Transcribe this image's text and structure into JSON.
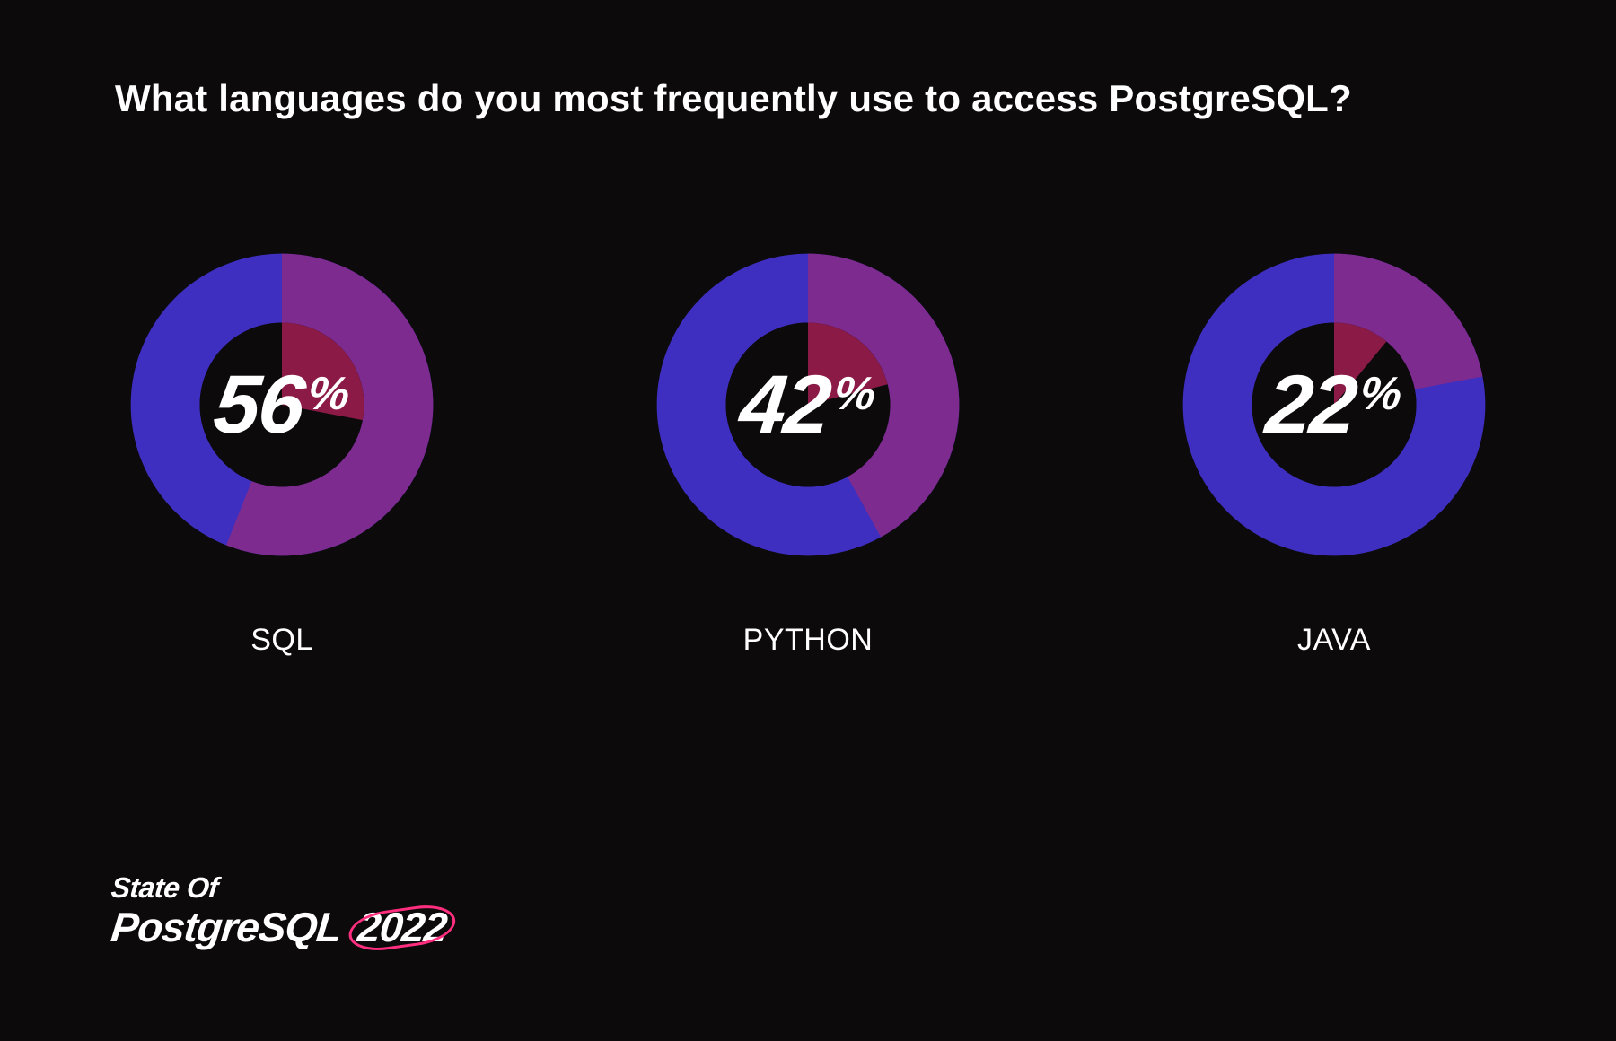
{
  "title": "What languages do you most frequently use to access PostgreSQL?",
  "percent_sign": "%",
  "footer": {
    "line1": "State Of",
    "line2_a": "PostgreSQL",
    "line2_b": "2022"
  },
  "colors": {
    "blue": "#3e2fc0",
    "purple": "#7d2b8f",
    "crimson": "#8b1a46",
    "bg": "#0d0a0c"
  },
  "chart_data": {
    "type": "pie",
    "title": "What languages do you most frequently use to access PostgreSQL?",
    "series": [
      {
        "name": "SQL",
        "value": 56
      },
      {
        "name": "PYTHON",
        "value": 42
      },
      {
        "name": "JAVA",
        "value": 22
      }
    ],
    "xlabel": "",
    "ylabel": "",
    "ylim": [
      0,
      100
    ]
  }
}
